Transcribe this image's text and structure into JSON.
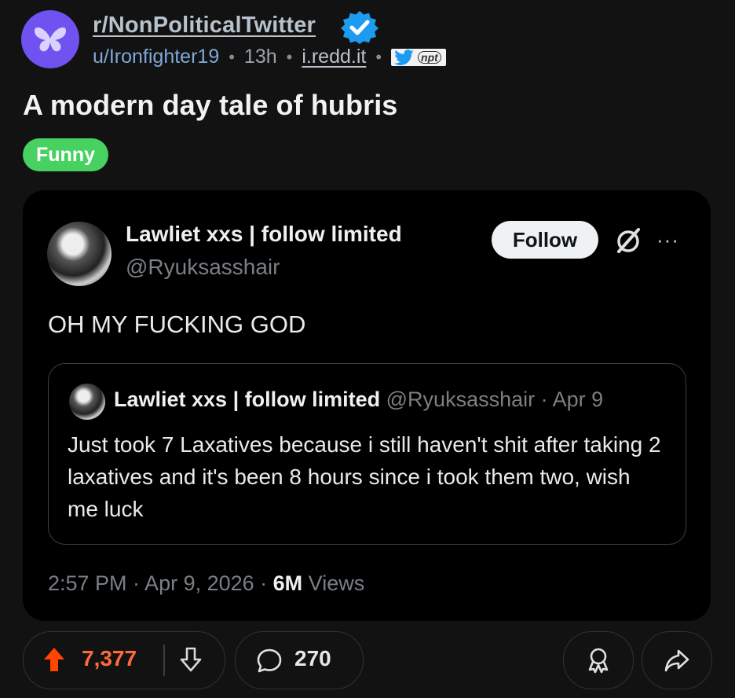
{
  "header": {
    "subreddit": "r/NonPoliticalTwitter",
    "user": "u/Ironfighter19",
    "age": "13h",
    "domain": "i.redd.it",
    "badge_text": "npt"
  },
  "post": {
    "title": "A modern day tale of hubris",
    "flair": "Funny"
  },
  "tweet": {
    "display_name": "Lawliet xxs | follow limited",
    "handle": "@Ryuksasshair",
    "follow_label": "Follow",
    "more_label": "···",
    "text": "OH MY FUCKING GOD",
    "quoted": {
      "display_name": "Lawliet xxs | follow limited",
      "handle_date": "@Ryuksasshair · Apr 9",
      "text": "Just took 7 Laxatives because i still haven't shit after taking 2 laxatives and it's been 8 hours since i took them two, wish me luck"
    },
    "footer_time": "2:57 PM · Apr 9, 2026 · ",
    "footer_views": "6M",
    "footer_views_label": " Views"
  },
  "actions": {
    "votes": "7,377",
    "comments": "270"
  },
  "colors": {
    "upvote": "#ff4500",
    "flair": "#46d160",
    "subreddit_icon": "#6f52f0",
    "verified": "#1d9bf0"
  }
}
